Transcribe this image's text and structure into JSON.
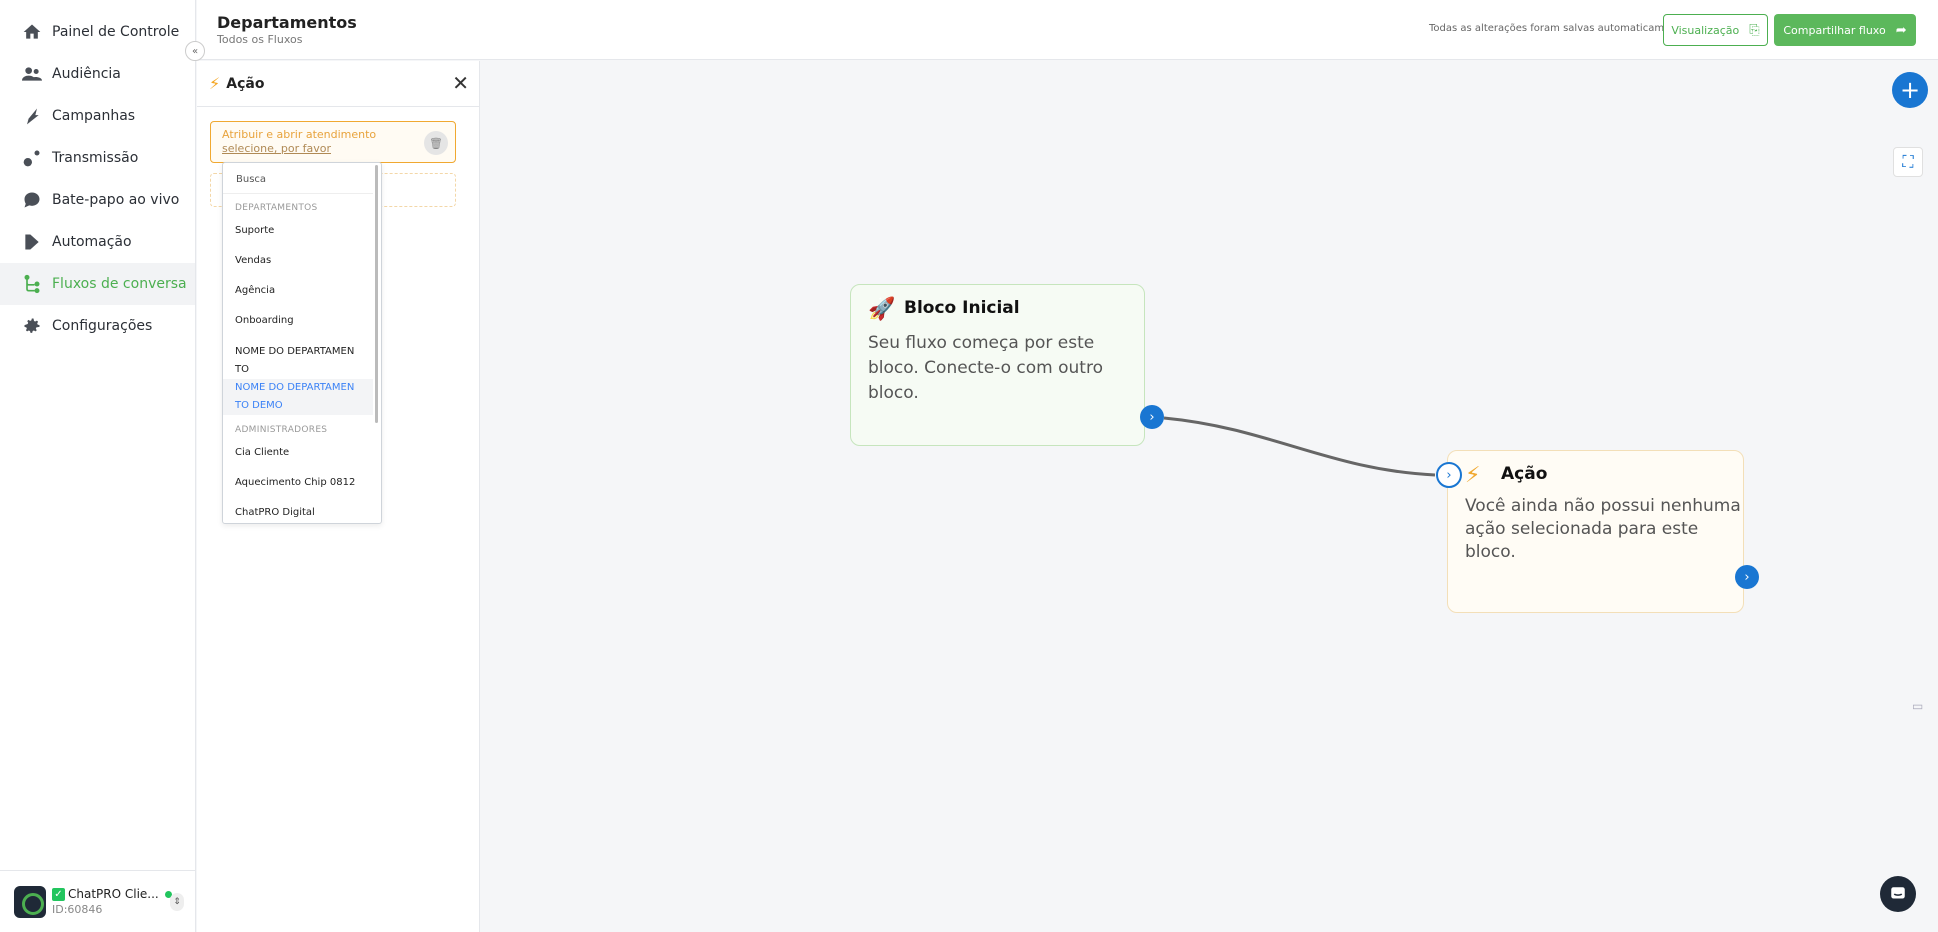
{
  "sidebar": {
    "items": [
      {
        "label": "Painel de Controle",
        "icon": "home-icon"
      },
      {
        "label": "Audiência",
        "icon": "users-icon"
      },
      {
        "label": "Campanhas",
        "icon": "campaign-icon"
      },
      {
        "label": "Transmissão",
        "icon": "broadcast-icon"
      },
      {
        "label": "Bate-papo ao vivo",
        "icon": "chat-bubble-icon"
      },
      {
        "label": "Automação",
        "icon": "automation-icon"
      },
      {
        "label": "Fluxos de conversa",
        "icon": "flow-icon"
      },
      {
        "label": "Configurações",
        "icon": "gear-icon"
      }
    ],
    "active_index": 6,
    "account": {
      "name": "ChatPRO Clie...",
      "id": "ID:60846"
    }
  },
  "header": {
    "title": "Departamentos",
    "breadcrumb": "Todos os Fluxos",
    "save_status": "Todas as alterações foram salvas automaticamente",
    "preview_label": "Visualização",
    "share_label": "Compartilhar fluxo"
  },
  "panel": {
    "title": "Ação",
    "action": {
      "name": "Atribuir e abrir atendimento",
      "select_prompt": "selecione, por favor"
    }
  },
  "dropdown": {
    "search_placeholder": "Busca",
    "group_departments": "DEPARTAMENTOS",
    "departments": [
      "Suporte",
      "Vendas",
      "Agência",
      "Onboarding"
    ],
    "dept_long_1": [
      "NOME DO DEPARTAMEN",
      "TO"
    ],
    "dept_long_2": [
      "NOME DO DEPARTAMEN",
      "TO DEMO"
    ],
    "group_admins": "ADMINISTRADORES",
    "admins": [
      "Cia Cliente",
      "Aquecimento Chip 0812",
      "ChatPRO Digital"
    ]
  },
  "canvas": {
    "start_node": {
      "title": "Bloco Inicial",
      "text": "Seu fluxo começa por este bloco. Conecte-o com outro bloco."
    },
    "action_node": {
      "title": "Ação",
      "text": "Você ainda não possui nenhuma ação selecionada para este bloco."
    }
  },
  "colors": {
    "brand_green": "#4caf50",
    "accent_blue": "#1976d2",
    "action_orange": "#f0a830"
  }
}
